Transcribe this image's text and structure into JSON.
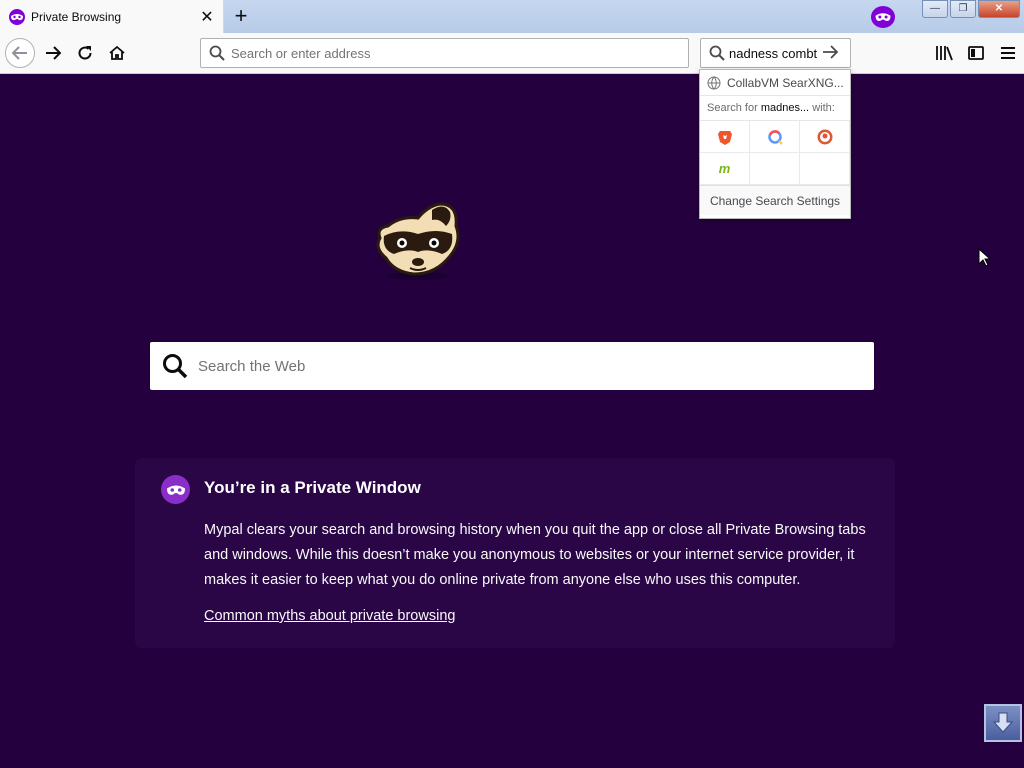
{
  "tab": {
    "title": "Private Browsing",
    "close_icon": "close-icon"
  },
  "toolbar": {
    "new_tab_label": "+",
    "back_icon": "back-arrow-icon",
    "forward_icon": "forward-arrow-icon",
    "reload_icon": "reload-icon",
    "home_icon": "home-icon",
    "address_placeholder": "Search or enter address",
    "search_value": "nadness combt",
    "library_icon": "library-icon",
    "sidebar_icon": "sidebar-icon",
    "menu_icon": "hamburger-menu-icon"
  },
  "search_popup": {
    "suggestion": "CollabVM SearXNG...",
    "search_for_prefix": "Search for",
    "search_for_term": "madnes...",
    "search_for_suffix": "with:",
    "engines": [
      "brave",
      "qwant",
      "duckduckgo",
      "mojeek"
    ],
    "change_settings": "Change Search Settings"
  },
  "content": {
    "web_search_placeholder": "Search the Web",
    "private_title": "You’re in a Private Window",
    "private_body": "Mypal clears your search and browsing history when you quit the app or close all Private Browsing tabs and windows. While this doesn’t make you anonymous to websites or your internet service provider, it makes it easier to keep what you do online private from anyone else who uses this computer.",
    "myths_link": "Common myths about private browsing"
  },
  "colors": {
    "background": "#25003e",
    "private_accent": "#8000d7",
    "card": "#2a0646"
  }
}
